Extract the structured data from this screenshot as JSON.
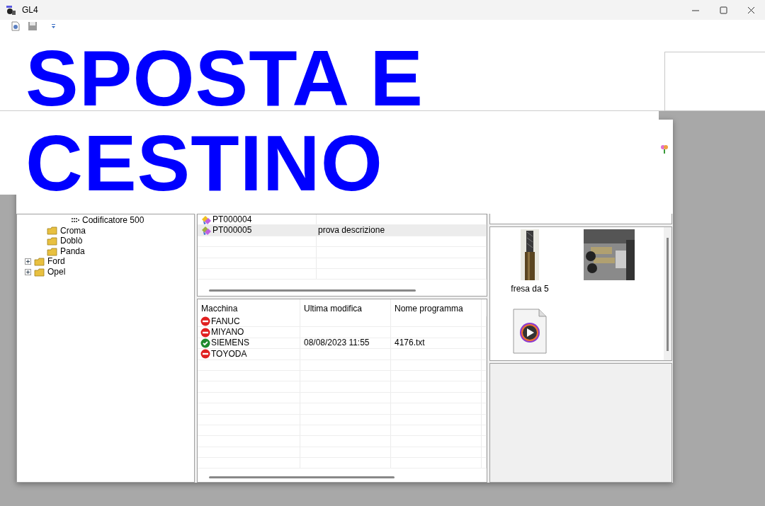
{
  "window": {
    "title": "GL4"
  },
  "toolbar": [
    {
      "kind": "settings"
    },
    {
      "kind": "save"
    },
    {
      "kind": "dropdown"
    }
  ],
  "overlay_title": [
    "SPOSTA E",
    "CESTINO"
  ],
  "tree": [
    {
      "children": [
        {
          "children": [
            {
              "label": "Codificatore 500",
              "kind": "device"
            }
          ]
        },
        {
          "label": "Croma",
          "kind": "folder"
        },
        {
          "label": "Doblò",
          "kind": "folder"
        },
        {
          "label": "Panda",
          "kind": "folder"
        }
      ]
    },
    {
      "label": "Ford",
      "kind": "folder",
      "expanded": false
    },
    {
      "label": "Opel",
      "kind": "folder",
      "expanded": false
    }
  ],
  "programs": {
    "rows": [
      {
        "code": "PT000004",
        "selected": false
      },
      {
        "code": "PT000005",
        "description": "prova descrizione",
        "selected": true
      }
    ]
  },
  "machines": {
    "columns": [
      "Macchina",
      "Ultima modifica",
      "Nome programma"
    ],
    "rows": [
      {
        "name": "FANUC",
        "active": false
      },
      {
        "name": "MIYANO",
        "active": false
      },
      {
        "name": "SIEMENS",
        "active": true,
        "modified": "08/08/2023 11:55",
        "program": "4176.txt"
      },
      {
        "name": "TOYODA",
        "active": false
      }
    ]
  },
  "attachments": [
    {
      "kind": "tool-photo",
      "caption": "fresa da 5"
    },
    {
      "kind": "machine-photo"
    },
    {
      "kind": "video"
    }
  ]
}
